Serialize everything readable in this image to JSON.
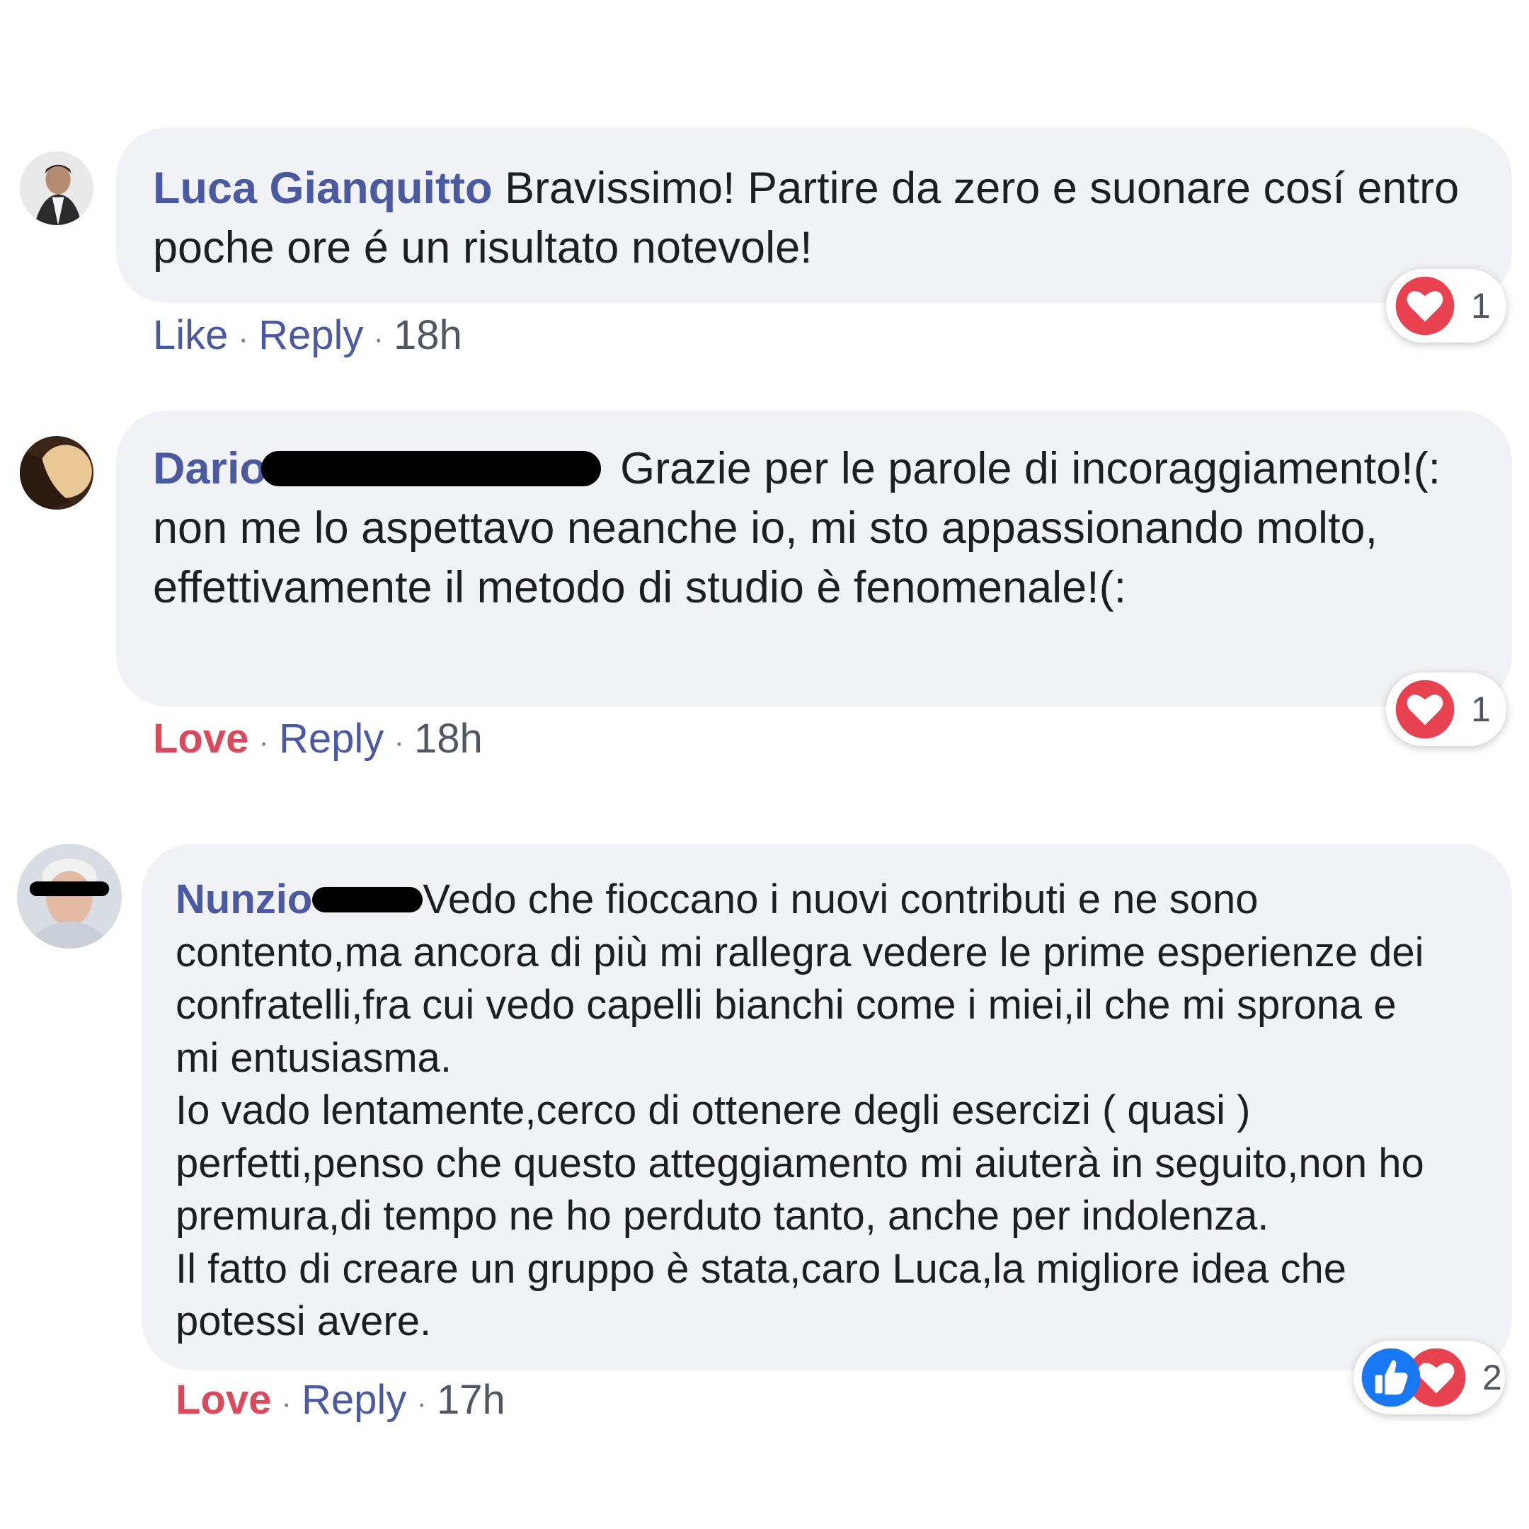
{
  "comments": [
    {
      "author": "Luca Gianquitto",
      "text": "Bravissimo! Partire da zero e suonare cosí entro poche ore é un risultato notevole!",
      "action": "Like",
      "reply": "Reply",
      "time": "18h",
      "reaction_count": "1",
      "reaction_icons": [
        "heart-icon"
      ]
    },
    {
      "author": "Dario",
      "text": "Grazie per le parole di incoraggiamento!(: non me lo aspettavo neanche io, mi sto appassionando molto, effettivamente il metodo di studio è fenomenale!(:",
      "action": "Love",
      "reply": "Reply",
      "time": "18h",
      "reaction_count": "1",
      "reaction_icons": [
        "heart-icon"
      ]
    },
    {
      "author": "Nunzio",
      "text_lines": [
        "Vedo che fioccano i nuovi contributi e ne sono",
        "contento,ma ancora di più mi rallegra vedere le prime esperienze dei",
        "confratelli,fra cui vedo capelli bianchi come i miei,il che mi sprona e",
        "mi entusiasma.",
        "Io vado lentamente,cerco di ottenere degli esercizi ( quasi )",
        "perfetti,penso che questo atteggiamento mi aiuterà in seguito,non ho",
        "premura,di tempo ne ho perduto tanto, anche per indolenza.",
        "Il fatto di creare un gruppo è stata,caro Luca,la migliore idea che",
        "potessi avere."
      ],
      "action": "Love",
      "reply": "Reply",
      "time": "17h",
      "reaction_count": "2",
      "reaction_icons": [
        "like-icon",
        "heart-icon"
      ]
    }
  ],
  "colors": {
    "author": "#4b5aa0",
    "love": "#d94a5c",
    "bubble": "#f0f2f5",
    "heart": "#e8414f",
    "like": "#1877f2"
  }
}
